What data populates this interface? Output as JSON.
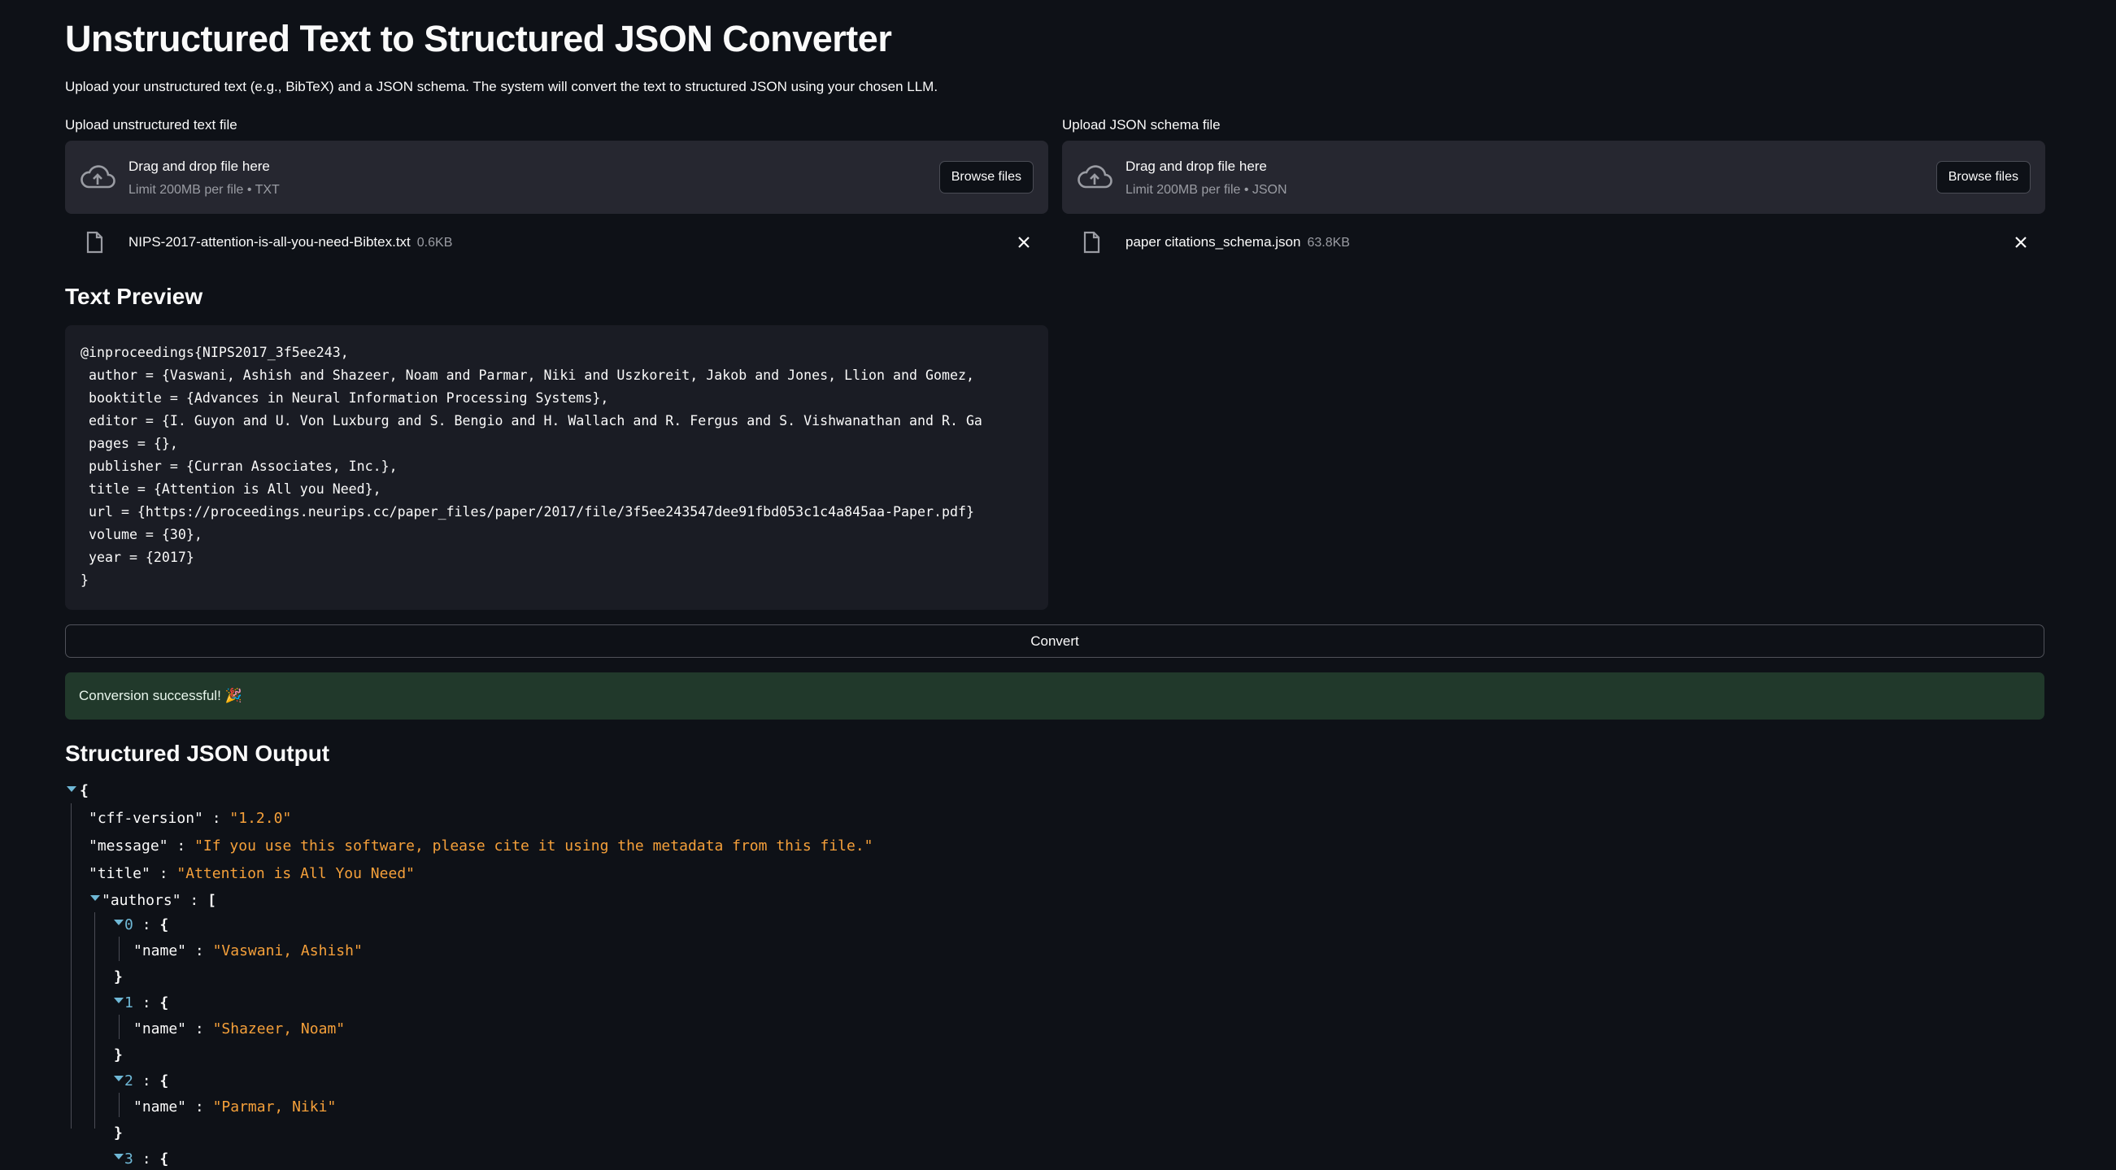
{
  "header": {
    "title": "Unstructured Text to Structured JSON Converter",
    "subtitle": "Upload your unstructured text (e.g., BibTeX) and a JSON schema. The system will convert the text to structured JSON using your chosen LLM."
  },
  "upload_text": {
    "label": "Upload unstructured text file",
    "drop_title": "Drag and drop file here",
    "limit": "Limit 200MB per file • TXT",
    "browse_label": "Browse files",
    "file_name": "NIPS-2017-attention-is-all-you-need-Bibtex.txt",
    "file_size": "0.6KB"
  },
  "upload_schema": {
    "label": "Upload JSON schema file",
    "drop_title": "Drag and drop file here",
    "limit": "Limit 200MB per file • JSON",
    "browse_label": "Browse files",
    "file_name": "paper citations_schema.json",
    "file_size": "63.8KB"
  },
  "preview": {
    "heading": "Text Preview",
    "text": "@inproceedings{NIPS2017_3f5ee243,\n author = {Vaswani, Ashish and Shazeer, Noam and Parmar, Niki and Uszkoreit, Jakob and Jones, Llion and Gomez,\n booktitle = {Advances in Neural Information Processing Systems},\n editor = {I. Guyon and U. Von Luxburg and S. Bengio and H. Wallach and R. Fergus and S. Vishwanathan and R. Ga\n pages = {},\n publisher = {Curran Associates, Inc.},\n title = {Attention is All you Need},\n url = {https://proceedings.neurips.cc/paper_files/paper/2017/file/3f5ee243547dee91fbd053c1c4a845aa-Paper.pdf}\n volume = {30},\n year = {2017}\n}"
  },
  "convert_label": "Convert",
  "success_message": "Conversion successful! 🎉",
  "output": {
    "heading": "Structured JSON Output",
    "open_brace": "{",
    "fields": [
      {
        "key": "\"cff-version\"",
        "value": "\"1.2.0\""
      },
      {
        "key": "\"message\"",
        "value": "\"If you use this software, please cite it using the metadata from this file.\""
      },
      {
        "key": "\"title\"",
        "value": "\"Attention is All You Need\""
      }
    ],
    "authors_key": "\"authors\"",
    "authors_open": "[",
    "authors": [
      {
        "index": "0",
        "name_key": "\"name\"",
        "name": "\"Vaswani, Ashish\""
      },
      {
        "index": "1",
        "name_key": "\"name\"",
        "name": "\"Shazeer, Noam\""
      },
      {
        "index": "2",
        "name_key": "\"name\"",
        "name": "\"Parmar, Niki\""
      }
    ],
    "next_index": "3",
    "obj_open": "{",
    "obj_close": "}",
    "colon": ":"
  },
  "icons": [
    "cloud-upload-icon",
    "file-icon",
    "close-icon",
    "expand-caret-icon"
  ]
}
